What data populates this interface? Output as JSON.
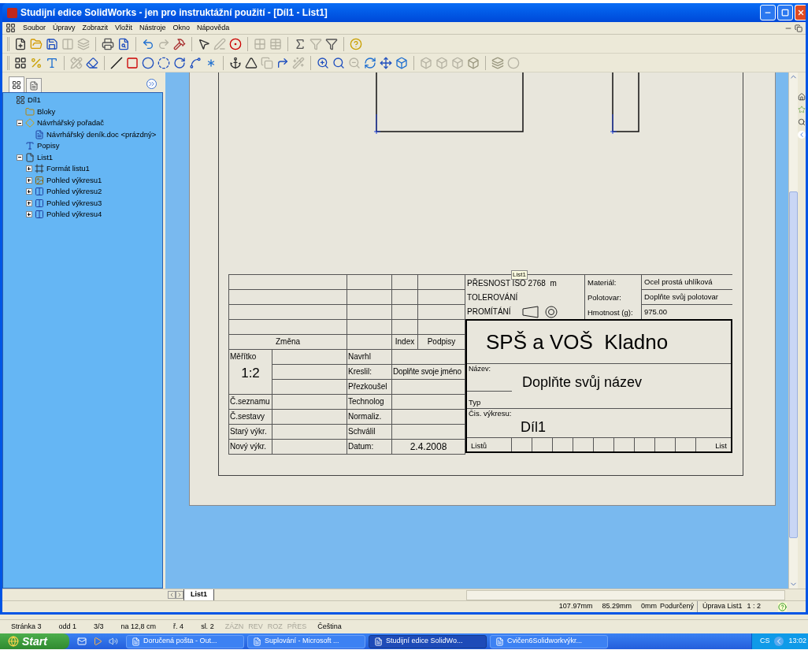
{
  "window": {
    "title": "Studijní edice SolidWorks - jen pro instruktážní použití - [Díl1 - List1]"
  },
  "menu": [
    "Soubor",
    "Úpravy",
    "Zobrazit",
    "Vložit",
    "Nástroje",
    "Okno",
    "Nápověda"
  ],
  "tree": [
    {
      "label": "Díl1",
      "kind": "drawing",
      "children": [
        {
          "label": "Bloky",
          "kind": "folder"
        },
        {
          "label": "Návrhářský pořadač",
          "kind": "binder",
          "expanded": true,
          "children": [
            {
              "label": "Návrhářský deník.doc <prázdný>",
              "kind": "document"
            }
          ]
        },
        {
          "label": "Popisy",
          "kind": "annotations"
        },
        {
          "label": "List1",
          "kind": "sheet",
          "expanded": true,
          "children": [
            {
              "label": "Formát listu1",
              "kind": "format",
              "expanded": false
            },
            {
              "label": "Pohled výkresu1",
              "kind": "part-view",
              "expanded": false
            },
            {
              "label": "Pohled výkresu2",
              "kind": "view",
              "expanded": false
            },
            {
              "label": "Pohled výkresu3",
              "kind": "view",
              "expanded": false
            },
            {
              "label": "Pohled výkresu4",
              "kind": "view",
              "expanded": false
            }
          ]
        }
      ]
    }
  ],
  "drawing": {
    "tooltip": "List1",
    "title_block": {
      "change_label": "Změna",
      "index_label": "Index",
      "signatures_label": "Podpisy",
      "scale": {
        "label": "Měřítko",
        "value": "1:2"
      },
      "left_labels": [
        "Č.seznamu",
        "Č.sestavy",
        "Starý výkr.",
        "Nový výkr."
      ],
      "roles": [
        {
          "label": "Navrhl"
        },
        {
          "label": "Kreslil:",
          "value": "Doplňte svoje jméno"
        },
        {
          "label": "Přezkoušel"
        },
        {
          "label": "Technolog"
        },
        {
          "label": "Normaliz."
        },
        {
          "label": "Schválil"
        },
        {
          "label": "Datum:",
          "value": "2.4.2008"
        }
      ],
      "tolerance": [
        "PŘESNOST ISO 2768  m",
        "TOLEROVÁNÍ",
        "PROMÍTÁNÍ"
      ],
      "properties": [
        {
          "label": "Materiál:",
          "value": "Ocel prostá uhlíková"
        },
        {
          "label": "Polotovar:",
          "value": "Doplňte svůj polotovar"
        },
        {
          "label": "Hmotnost (g):",
          "value": "975.00"
        }
      ],
      "school": "SPŠ a VOŠ  Kladno",
      "name_label": "Název:",
      "name": "Doplňte svůj název",
      "type_label": "Typ",
      "number_label": "Čis. výkresu:",
      "number": "Díl1",
      "sheets_label": "Listů",
      "sheet_label": "List"
    }
  },
  "sheet_tabs": [
    {
      "label": "List1",
      "selected": true
    }
  ],
  "status_bar": {
    "x": "107.97mm",
    "y": "85.29mm",
    "z": "0mm",
    "state": "Podurčený",
    "mode": "Úprava List1",
    "scale": "1 : 2"
  },
  "word_status": [
    {
      "text": "Stránka 3",
      "disabled": false
    },
    {
      "text": "odd 1",
      "disabled": false
    },
    {
      "text": "3/3",
      "disabled": false
    },
    {
      "text": "na 12,8 cm",
      "disabled": false
    },
    {
      "text": "ř. 4",
      "disabled": false
    },
    {
      "text": "sl. 2",
      "disabled": false
    },
    {
      "text": "ZÁZN",
      "disabled": true
    },
    {
      "text": "REV",
      "disabled": true
    },
    {
      "text": "ROZ",
      "disabled": true
    },
    {
      "text": "PŘES",
      "disabled": true
    },
    {
      "text": "Čeština",
      "disabled": false
    }
  ],
  "taskbar": {
    "start": "Start",
    "tasks": [
      {
        "label": "Doručená pošta - Out...",
        "selected": false
      },
      {
        "label": "Suplování - Microsoft ...",
        "selected": false
      },
      {
        "label": "Studijní edice SolidWo...",
        "selected": true
      },
      {
        "label": "Cvičen6Solidworkvýkr...",
        "selected": false
      }
    ],
    "language": "CS",
    "clock": "13:02"
  }
}
